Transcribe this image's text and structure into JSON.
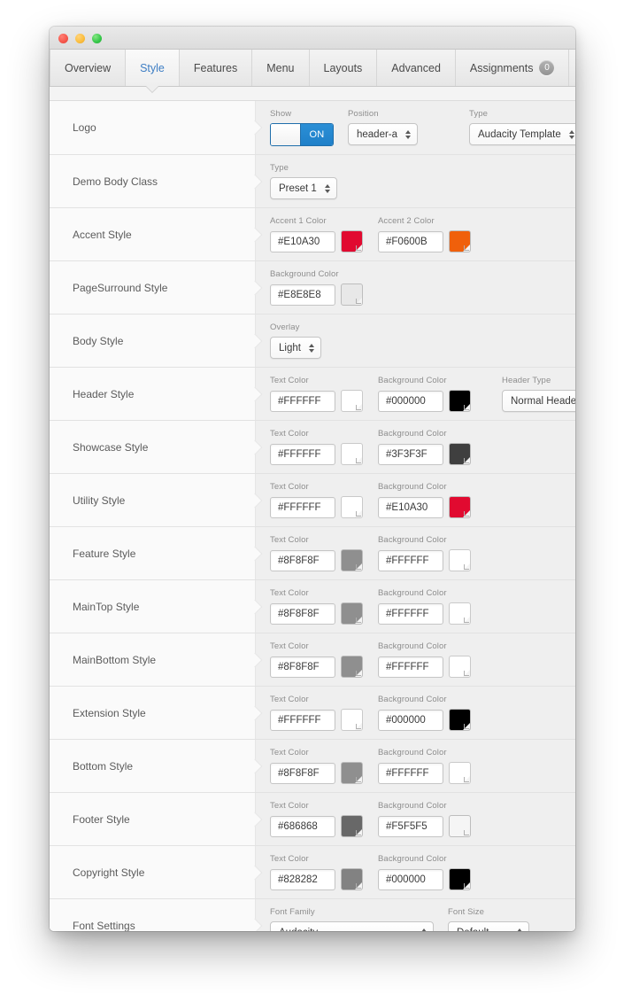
{
  "window": {
    "traffic_lights": [
      "close",
      "minimize",
      "zoom"
    ]
  },
  "tabs": [
    {
      "label": "Overview",
      "active": false
    },
    {
      "label": "Style",
      "active": true
    },
    {
      "label": "Features",
      "active": false
    },
    {
      "label": "Menu",
      "active": false
    },
    {
      "label": "Layouts",
      "active": false
    },
    {
      "label": "Advanced",
      "active": false
    },
    {
      "label": "Assignments",
      "active": false,
      "badge": "0"
    }
  ],
  "rows": [
    {
      "label": "Logo",
      "fields": [
        {
          "kind": "toggle",
          "label": "Show",
          "value": "ON"
        },
        {
          "kind": "select",
          "label": "Position",
          "value": "header-a"
        },
        {
          "kind": "select",
          "label": "Type",
          "value": "Audacity Template"
        }
      ]
    },
    {
      "label": "Demo Body Class",
      "fields": [
        {
          "kind": "select",
          "label": "Type",
          "value": "Preset 1"
        }
      ]
    },
    {
      "label": "Accent Style",
      "fields": [
        {
          "kind": "color",
          "label": "Accent 1 Color",
          "value": "#E10A30",
          "swatch": "#E10A30"
        },
        {
          "kind": "color",
          "label": "Accent 2 Color",
          "value": "#F0600B",
          "swatch": "#F0600B"
        }
      ]
    },
    {
      "label": "PageSurround Style",
      "fields": [
        {
          "kind": "color",
          "label": "Background Color",
          "value": "#E8E8E8",
          "swatch": "#E8E8E8"
        }
      ]
    },
    {
      "label": "Body Style",
      "fields": [
        {
          "kind": "select",
          "label": "Overlay",
          "value": "Light"
        }
      ]
    },
    {
      "label": "Header Style",
      "fields": [
        {
          "kind": "color",
          "label": "Text Color",
          "value": "#FFFFFF",
          "swatch": "#FFFFFF"
        },
        {
          "kind": "color",
          "label": "Background Color",
          "value": "#000000",
          "swatch": "#000000"
        },
        {
          "kind": "select",
          "label": "Header Type",
          "value": "Normal Header"
        }
      ]
    },
    {
      "label": "Showcase Style",
      "fields": [
        {
          "kind": "color",
          "label": "Text Color",
          "value": "#FFFFFF",
          "swatch": "#FFFFFF"
        },
        {
          "kind": "color",
          "label": "Background Color",
          "value": "#3F3F3F",
          "swatch": "#3F3F3F"
        }
      ]
    },
    {
      "label": "Utility Style",
      "fields": [
        {
          "kind": "color",
          "label": "Text Color",
          "value": "#FFFFFF",
          "swatch": "#FFFFFF"
        },
        {
          "kind": "color",
          "label": "Background Color",
          "value": "#E10A30",
          "swatch": "#E10A30"
        }
      ]
    },
    {
      "label": "Feature Style",
      "fields": [
        {
          "kind": "color",
          "label": "Text Color",
          "value": "#8F8F8F",
          "swatch": "#8F8F8F"
        },
        {
          "kind": "color",
          "label": "Background Color",
          "value": "#FFFFFF",
          "swatch": "#FFFFFF"
        }
      ]
    },
    {
      "label": "MainTop Style",
      "fields": [
        {
          "kind": "color",
          "label": "Text Color",
          "value": "#8F8F8F",
          "swatch": "#8F8F8F"
        },
        {
          "kind": "color",
          "label": "Background Color",
          "value": "#FFFFFF",
          "swatch": "#FFFFFF"
        }
      ]
    },
    {
      "label": "MainBottom Style",
      "fields": [
        {
          "kind": "color",
          "label": "Text Color",
          "value": "#8F8F8F",
          "swatch": "#8F8F8F"
        },
        {
          "kind": "color",
          "label": "Background Color",
          "value": "#FFFFFF",
          "swatch": "#FFFFFF"
        }
      ]
    },
    {
      "label": "Extension Style",
      "fields": [
        {
          "kind": "color",
          "label": "Text Color",
          "value": "#FFFFFF",
          "swatch": "#FFFFFF"
        },
        {
          "kind": "color",
          "label": "Background Color",
          "value": "#000000",
          "swatch": "#000000"
        }
      ]
    },
    {
      "label": "Bottom Style",
      "fields": [
        {
          "kind": "color",
          "label": "Text Color",
          "value": "#8F8F8F",
          "swatch": "#8F8F8F"
        },
        {
          "kind": "color",
          "label": "Background Color",
          "value": "#FFFFFF",
          "swatch": "#FFFFFF"
        }
      ]
    },
    {
      "label": "Footer Style",
      "fields": [
        {
          "kind": "color",
          "label": "Text Color",
          "value": "#686868",
          "swatch": "#686868"
        },
        {
          "kind": "color",
          "label": "Background Color",
          "value": "#F5F5F5",
          "swatch": "#F5F5F5"
        }
      ]
    },
    {
      "label": "Copyright Style",
      "fields": [
        {
          "kind": "color",
          "label": "Text Color",
          "value": "#828282",
          "swatch": "#828282"
        },
        {
          "kind": "color",
          "label": "Background Color",
          "value": "#000000",
          "swatch": "#000000"
        }
      ]
    },
    {
      "label": "Font Settings",
      "fields": [
        {
          "kind": "select",
          "label": "Font Family",
          "value": "Audacity",
          "width": 185
        },
        {
          "kind": "select",
          "label": "Font Size",
          "value": "Default",
          "width": 92
        }
      ]
    }
  ]
}
